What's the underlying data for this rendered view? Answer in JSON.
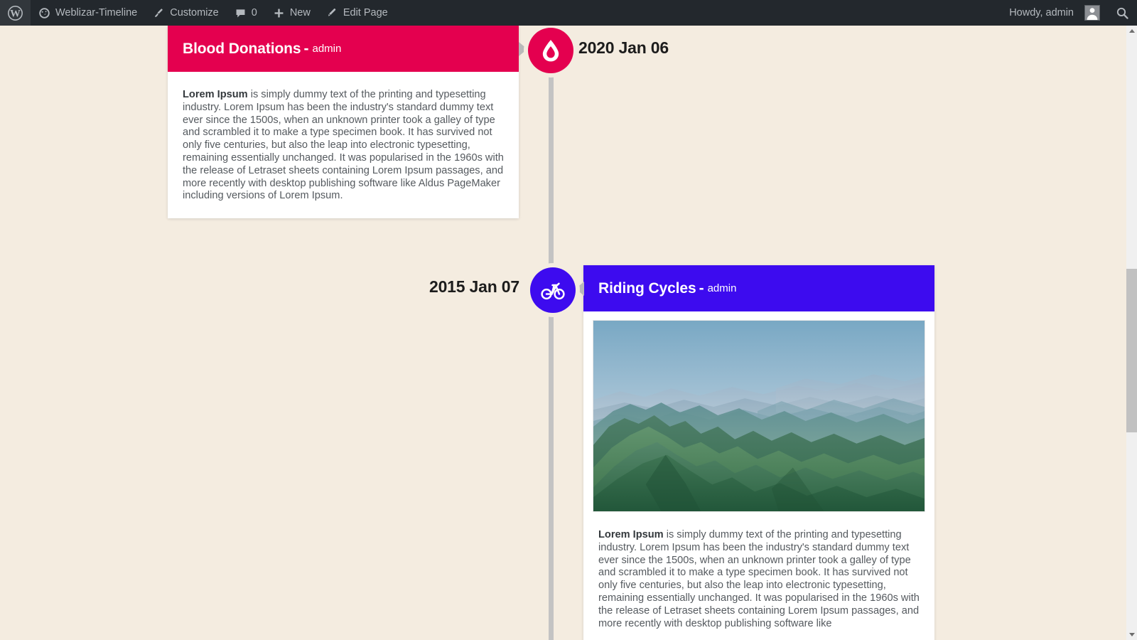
{
  "adminbar": {
    "wp_logo": "wordpress-logo",
    "site_name": "Weblizar-Timeline",
    "customize": "Customize",
    "comment_count": "0",
    "new": "New",
    "edit_page": "Edit Page",
    "howdy": "Howdy, admin",
    "search": "search-icon"
  },
  "theme": {
    "background": "#f4ece0",
    "spine": "#c3c3c3",
    "adminbar_bg": "#23282d"
  },
  "timeline": {
    "entries": [
      {
        "side": "left",
        "date": "2020 Jan 06",
        "title": "Blood Donations",
        "separator": "-",
        "author": "admin",
        "color": "#e4004f",
        "icon": "blood-drop-icon",
        "has_image": false,
        "body_lead": "Lorem Ipsum",
        "body": " is simply dummy text of the printing and typesetting industry. Lorem Ipsum has been the industry's standard dummy text ever since the 1500s, when an unknown printer took a galley of type and scrambled it to make a type specimen book. It has survived not only five centuries, but also the leap into electronic typesetting, remaining essentially unchanged. It was popularised in the 1960s with the release of Letraset sheets containing Lorem Ipsum passages, and more recently with desktop publishing software like Aldus PageMaker including versions of Lorem Ipsum."
      },
      {
        "side": "right",
        "date": "2015 Jan 07",
        "title": "Riding Cycles",
        "separator": "-",
        "author": "admin",
        "color": "#3d0bef",
        "icon": "bicycle-icon",
        "has_image": true,
        "image_alt": "mountain-range-landscape",
        "body_lead": "Lorem Ipsum",
        "body": " is simply dummy text of the printing and typesetting industry. Lorem Ipsum has been the industry's standard dummy text ever since the 1500s, when an unknown printer took a galley of type and scrambled it to make a type specimen book. It has survived not only five centuries, but also the leap into electronic typesetting, remaining essentially unchanged. It was popularised in the 1960s with the release of Letraset sheets containing Lorem Ipsum passages, and more recently with desktop publishing software like"
      }
    ]
  }
}
